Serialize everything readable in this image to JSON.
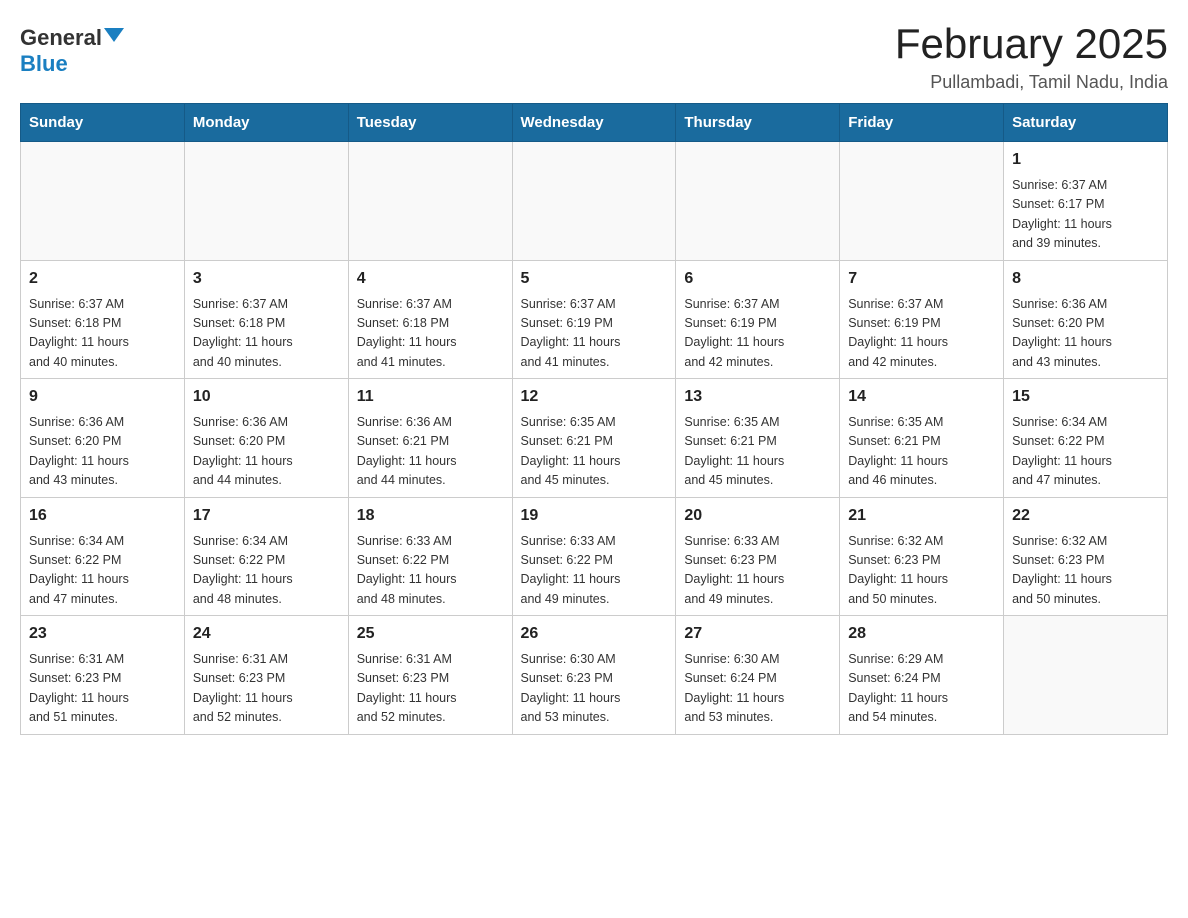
{
  "header": {
    "logo_general": "General",
    "logo_blue": "Blue",
    "month_title": "February 2025",
    "location": "Pullambadi, Tamil Nadu, India"
  },
  "weekdays": [
    "Sunday",
    "Monday",
    "Tuesday",
    "Wednesday",
    "Thursday",
    "Friday",
    "Saturday"
  ],
  "weeks": [
    [
      {
        "day": "",
        "info": ""
      },
      {
        "day": "",
        "info": ""
      },
      {
        "day": "",
        "info": ""
      },
      {
        "day": "",
        "info": ""
      },
      {
        "day": "",
        "info": ""
      },
      {
        "day": "",
        "info": ""
      },
      {
        "day": "1",
        "info": "Sunrise: 6:37 AM\nSunset: 6:17 PM\nDaylight: 11 hours\nand 39 minutes."
      }
    ],
    [
      {
        "day": "2",
        "info": "Sunrise: 6:37 AM\nSunset: 6:18 PM\nDaylight: 11 hours\nand 40 minutes."
      },
      {
        "day": "3",
        "info": "Sunrise: 6:37 AM\nSunset: 6:18 PM\nDaylight: 11 hours\nand 40 minutes."
      },
      {
        "day": "4",
        "info": "Sunrise: 6:37 AM\nSunset: 6:18 PM\nDaylight: 11 hours\nand 41 minutes."
      },
      {
        "day": "5",
        "info": "Sunrise: 6:37 AM\nSunset: 6:19 PM\nDaylight: 11 hours\nand 41 minutes."
      },
      {
        "day": "6",
        "info": "Sunrise: 6:37 AM\nSunset: 6:19 PM\nDaylight: 11 hours\nand 42 minutes."
      },
      {
        "day": "7",
        "info": "Sunrise: 6:37 AM\nSunset: 6:19 PM\nDaylight: 11 hours\nand 42 minutes."
      },
      {
        "day": "8",
        "info": "Sunrise: 6:36 AM\nSunset: 6:20 PM\nDaylight: 11 hours\nand 43 minutes."
      }
    ],
    [
      {
        "day": "9",
        "info": "Sunrise: 6:36 AM\nSunset: 6:20 PM\nDaylight: 11 hours\nand 43 minutes."
      },
      {
        "day": "10",
        "info": "Sunrise: 6:36 AM\nSunset: 6:20 PM\nDaylight: 11 hours\nand 44 minutes."
      },
      {
        "day": "11",
        "info": "Sunrise: 6:36 AM\nSunset: 6:21 PM\nDaylight: 11 hours\nand 44 minutes."
      },
      {
        "day": "12",
        "info": "Sunrise: 6:35 AM\nSunset: 6:21 PM\nDaylight: 11 hours\nand 45 minutes."
      },
      {
        "day": "13",
        "info": "Sunrise: 6:35 AM\nSunset: 6:21 PM\nDaylight: 11 hours\nand 45 minutes."
      },
      {
        "day": "14",
        "info": "Sunrise: 6:35 AM\nSunset: 6:21 PM\nDaylight: 11 hours\nand 46 minutes."
      },
      {
        "day": "15",
        "info": "Sunrise: 6:34 AM\nSunset: 6:22 PM\nDaylight: 11 hours\nand 47 minutes."
      }
    ],
    [
      {
        "day": "16",
        "info": "Sunrise: 6:34 AM\nSunset: 6:22 PM\nDaylight: 11 hours\nand 47 minutes."
      },
      {
        "day": "17",
        "info": "Sunrise: 6:34 AM\nSunset: 6:22 PM\nDaylight: 11 hours\nand 48 minutes."
      },
      {
        "day": "18",
        "info": "Sunrise: 6:33 AM\nSunset: 6:22 PM\nDaylight: 11 hours\nand 48 minutes."
      },
      {
        "day": "19",
        "info": "Sunrise: 6:33 AM\nSunset: 6:22 PM\nDaylight: 11 hours\nand 49 minutes."
      },
      {
        "day": "20",
        "info": "Sunrise: 6:33 AM\nSunset: 6:23 PM\nDaylight: 11 hours\nand 49 minutes."
      },
      {
        "day": "21",
        "info": "Sunrise: 6:32 AM\nSunset: 6:23 PM\nDaylight: 11 hours\nand 50 minutes."
      },
      {
        "day": "22",
        "info": "Sunrise: 6:32 AM\nSunset: 6:23 PM\nDaylight: 11 hours\nand 50 minutes."
      }
    ],
    [
      {
        "day": "23",
        "info": "Sunrise: 6:31 AM\nSunset: 6:23 PM\nDaylight: 11 hours\nand 51 minutes."
      },
      {
        "day": "24",
        "info": "Sunrise: 6:31 AM\nSunset: 6:23 PM\nDaylight: 11 hours\nand 52 minutes."
      },
      {
        "day": "25",
        "info": "Sunrise: 6:31 AM\nSunset: 6:23 PM\nDaylight: 11 hours\nand 52 minutes."
      },
      {
        "day": "26",
        "info": "Sunrise: 6:30 AM\nSunset: 6:23 PM\nDaylight: 11 hours\nand 53 minutes."
      },
      {
        "day": "27",
        "info": "Sunrise: 6:30 AM\nSunset: 6:24 PM\nDaylight: 11 hours\nand 53 minutes."
      },
      {
        "day": "28",
        "info": "Sunrise: 6:29 AM\nSunset: 6:24 PM\nDaylight: 11 hours\nand 54 minutes."
      },
      {
        "day": "",
        "info": ""
      }
    ]
  ]
}
